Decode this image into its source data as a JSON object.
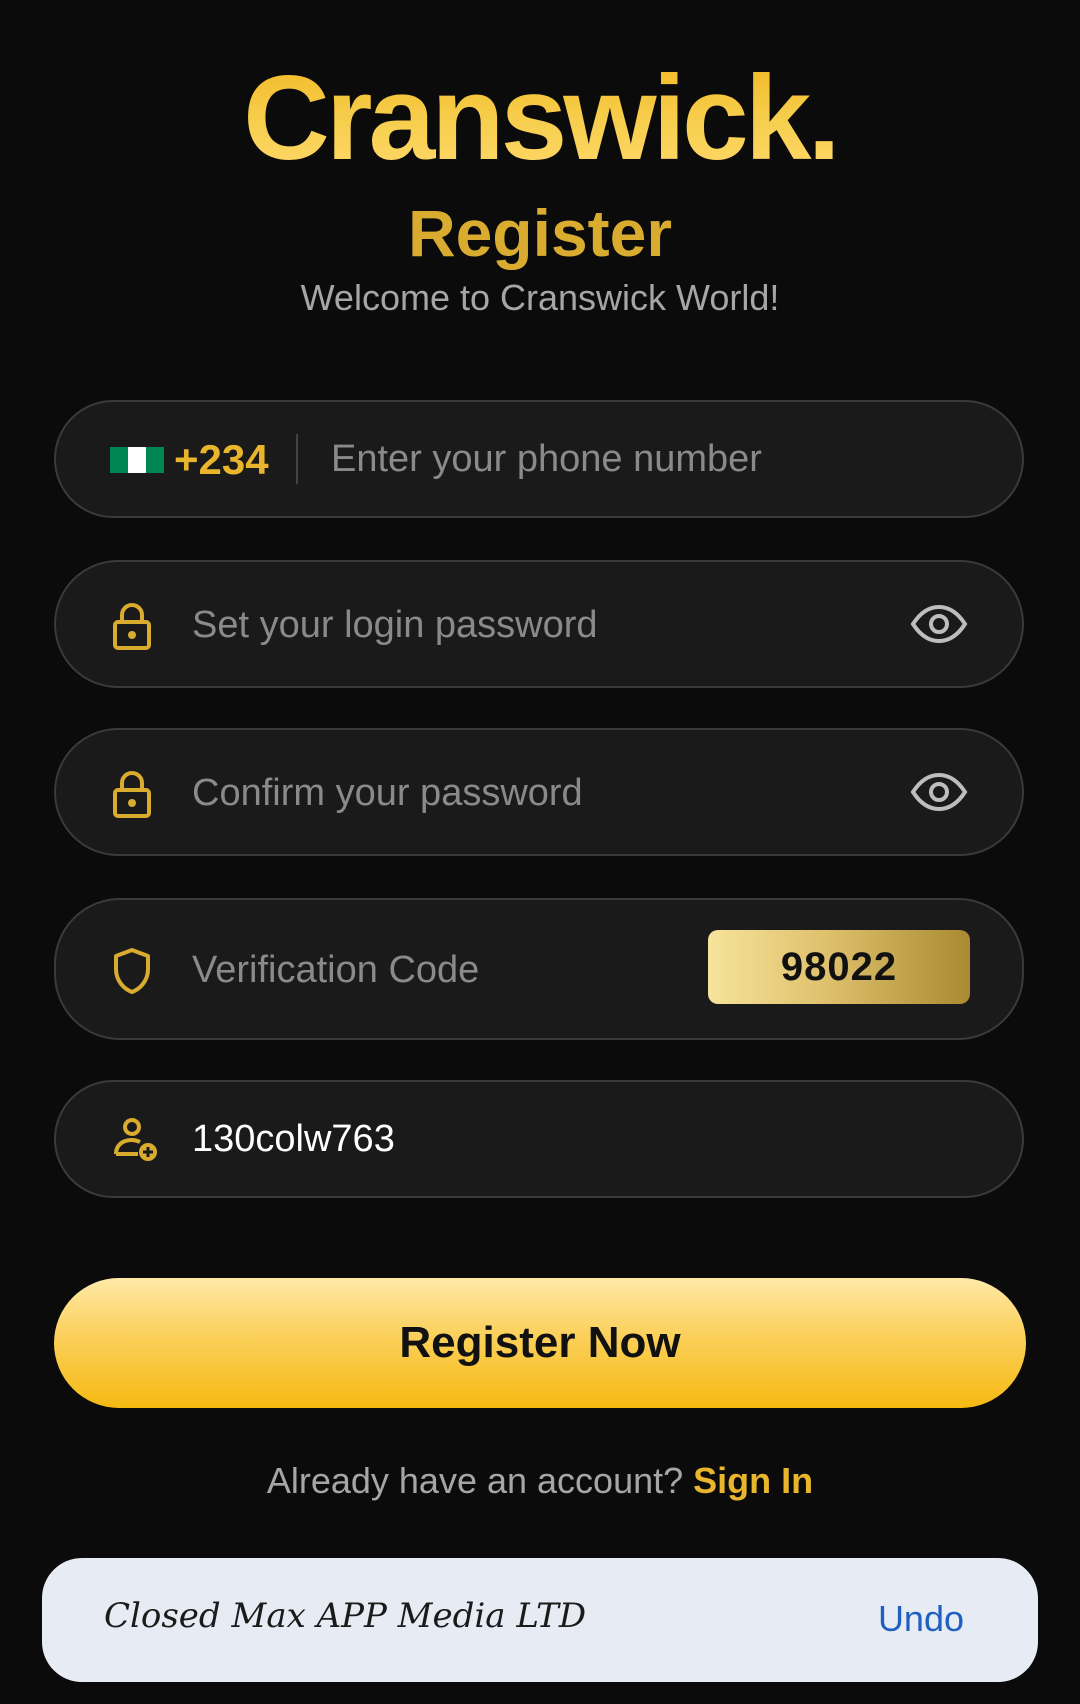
{
  "brand": {
    "logo": "Cranswick."
  },
  "header": {
    "title": "Register",
    "subtitle": "Welcome to Cranswick World!"
  },
  "form": {
    "phone": {
      "country_code": "+234",
      "placeholder": "Enter your phone number",
      "flag_colors": [
        "#008751",
        "#ffffff",
        "#008751"
      ]
    },
    "password": {
      "placeholder": "Set your login password",
      "icon": "lock-icon",
      "toggle_icon": "eye-icon"
    },
    "confirm_password": {
      "placeholder": "Confirm your password",
      "icon": "lock-icon",
      "toggle_icon": "eye-icon"
    },
    "verification": {
      "placeholder": "Verification Code",
      "icon": "shield-icon",
      "captcha": "98022"
    },
    "invite": {
      "value": "130colw763",
      "icon": "add-user-icon"
    },
    "submit_label": "Register Now"
  },
  "footer": {
    "prompt": "Already have an account?",
    "signin_label": "Sign In"
  },
  "toast": {
    "message": "Closed Max APP Media LTD",
    "action": "Undo"
  },
  "colors": {
    "background": "#0b0b0b",
    "accent_gold": "#e8b52c",
    "field_bg": "#1a1a1a",
    "toast_bg": "#e6ebf4",
    "toast_action": "#1f5fc0"
  }
}
